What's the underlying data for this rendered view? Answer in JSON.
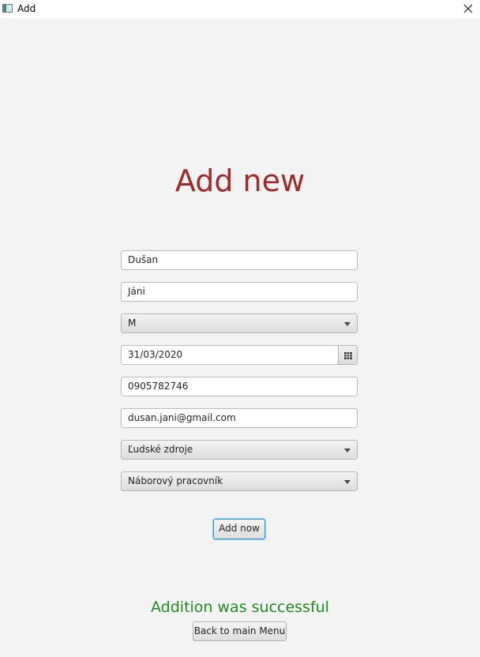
{
  "window": {
    "title": "Add",
    "icon": "app-window-icon",
    "close_icon": "close-icon"
  },
  "form": {
    "heading": "Add new",
    "first_name": "Dušan",
    "last_name": "Jáni",
    "gender": "M",
    "birth_date": "31/03/2020",
    "phone": "0905782746",
    "email": "dusan.jani@gmail.com",
    "department": "Ľudské zdroje",
    "position": "Náborový pracovník",
    "add_button": "Add now",
    "calendar_icon": "calendar-icon",
    "dropdown_icon": "chevron-down-icon"
  },
  "status": {
    "message": "Addition was successful",
    "color": "#1e8a1e"
  },
  "navigation": {
    "back_button": "Back to main Menu"
  },
  "colors": {
    "heading": "#9e2a2a",
    "background": "#f3f3f3",
    "focus_border": "#3b9bd7"
  }
}
